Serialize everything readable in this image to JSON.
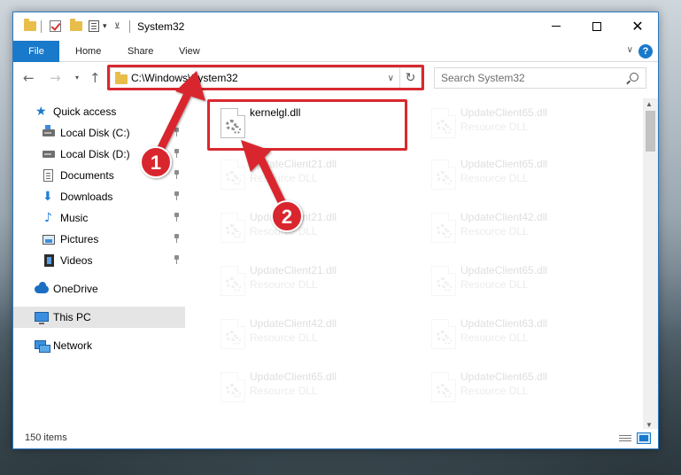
{
  "window": {
    "title": "System32",
    "controls": {
      "minimize": "—",
      "maximize": "☐",
      "close": "✕"
    }
  },
  "ribbon": {
    "tabs": [
      "File",
      "Home",
      "Share",
      "View"
    ],
    "help": "?"
  },
  "nav": {
    "back": "←",
    "forward": "→",
    "up": "↑",
    "address": "C:\\Windows\\System32",
    "search_placeholder": "Search System32"
  },
  "sidebar": {
    "items": [
      {
        "label": "Quick access",
        "icon": "star-icon",
        "pinned": false
      },
      {
        "label": "Local Disk (C:)",
        "icon": "drive-c-icon",
        "pinned": true
      },
      {
        "label": "Local Disk (D:)",
        "icon": "drive-d-icon",
        "pinned": true
      },
      {
        "label": "Documents",
        "icon": "documents-icon",
        "pinned": true
      },
      {
        "label": "Downloads",
        "icon": "downloads-icon",
        "pinned": true
      },
      {
        "label": "Music",
        "icon": "music-icon",
        "pinned": true
      },
      {
        "label": "Pictures",
        "icon": "pictures-icon",
        "pinned": true
      },
      {
        "label": "Videos",
        "icon": "videos-icon",
        "pinned": true
      },
      {
        "label": "OneDrive",
        "icon": "onedrive-icon",
        "pinned": false
      },
      {
        "label": "This PC",
        "icon": "this-pc-icon",
        "pinned": false,
        "selected": true
      },
      {
        "label": "Network",
        "icon": "network-icon",
        "pinned": false
      }
    ]
  },
  "files": {
    "highlighted": {
      "name": "kernelgl.dll",
      "desc": ""
    },
    "left_column": [
      {
        "name": "UpdateClient21.dll",
        "desc": "Resource DLL"
      },
      {
        "name": "UpdateClient21.dll",
        "desc": "Resource DLL"
      },
      {
        "name": "UpdateClient21.dll",
        "desc": "Resource DLL"
      },
      {
        "name": "UpdateClient42.dll",
        "desc": "Resource DLL"
      },
      {
        "name": "UpdateClient65.dll",
        "desc": "Resource DLL"
      }
    ],
    "right_column": [
      {
        "name": "UpdateClient65.dll",
        "desc": "Resource DLL"
      },
      {
        "name": "UpdateClient65.dll",
        "desc": "Resource DLL"
      },
      {
        "name": "UpdateClient42.dll",
        "desc": "Resource DLL"
      },
      {
        "name": "UpdateClient65.dll",
        "desc": "Resource DLL"
      },
      {
        "name": "UpdateClient63.dll",
        "desc": "Resource DLL"
      },
      {
        "name": "UpdateClient65.dll",
        "desc": "Resource DLL"
      }
    ]
  },
  "status": {
    "count": "150 items"
  },
  "annotations": {
    "step1": "1",
    "step2": "2",
    "color": "#d9282f"
  }
}
